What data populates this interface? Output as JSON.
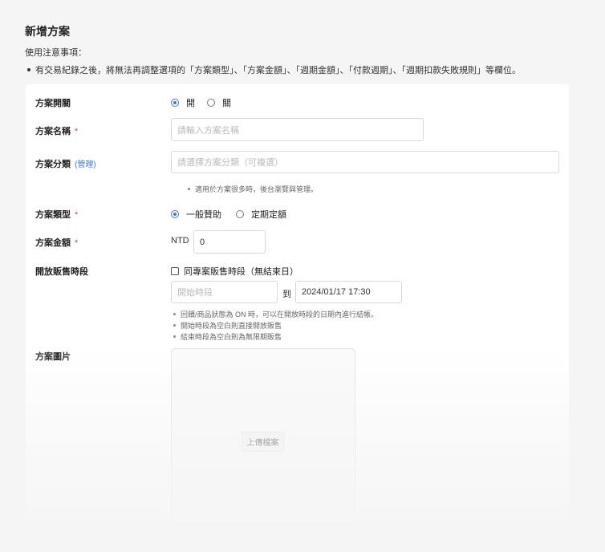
{
  "page": {
    "title": "新增方案",
    "notice_heading": "使用注意事項：",
    "notice_item": "有交易紀錄之後，將無法再調整選項的「方案類型」、「方案金額」、「週期金額」、「付款週期」、「週期扣款失敗規則」等欄位。"
  },
  "form": {
    "toggle": {
      "label": "方案開關",
      "options": [
        "開",
        "關"
      ],
      "selected": "開"
    },
    "name": {
      "label": "方案名稱",
      "required_mark": "*",
      "placeholder": "請輸入方案名稱"
    },
    "category": {
      "label": "方案分類",
      "manage_link": "(管理)",
      "placeholder": "請選擇方案分類（可複選）",
      "hint": "適用於方案很多時，後台瀏覽與管理。"
    },
    "type": {
      "label": "方案類型",
      "required_mark": "*",
      "options": [
        "一般贊助",
        "定期定額"
      ],
      "selected": "一般贊助"
    },
    "amount": {
      "label": "方案金額",
      "required_mark": "*",
      "currency": "NTD",
      "value": "0"
    },
    "sale_period": {
      "label": "開放販售時段",
      "checkbox_label": "同專案販售時段（無結束日）",
      "checked": false,
      "start_placeholder": "開始時段",
      "separator": "到",
      "end_value": "2024/01/17 17:30",
      "hints": [
        "回饋/商品狀態為 ON 時，可以在開放時段的日期內進行結帳。",
        "開始時段為空白則直接開放販售",
        "結束時段為空白則為無限期販售"
      ]
    },
    "image": {
      "label": "方案圖片",
      "upload_label": "上傳檔案"
    }
  },
  "colors": {
    "accent": "#3a7bd5",
    "required": "#e0424a",
    "background": "#f5f5f5"
  }
}
